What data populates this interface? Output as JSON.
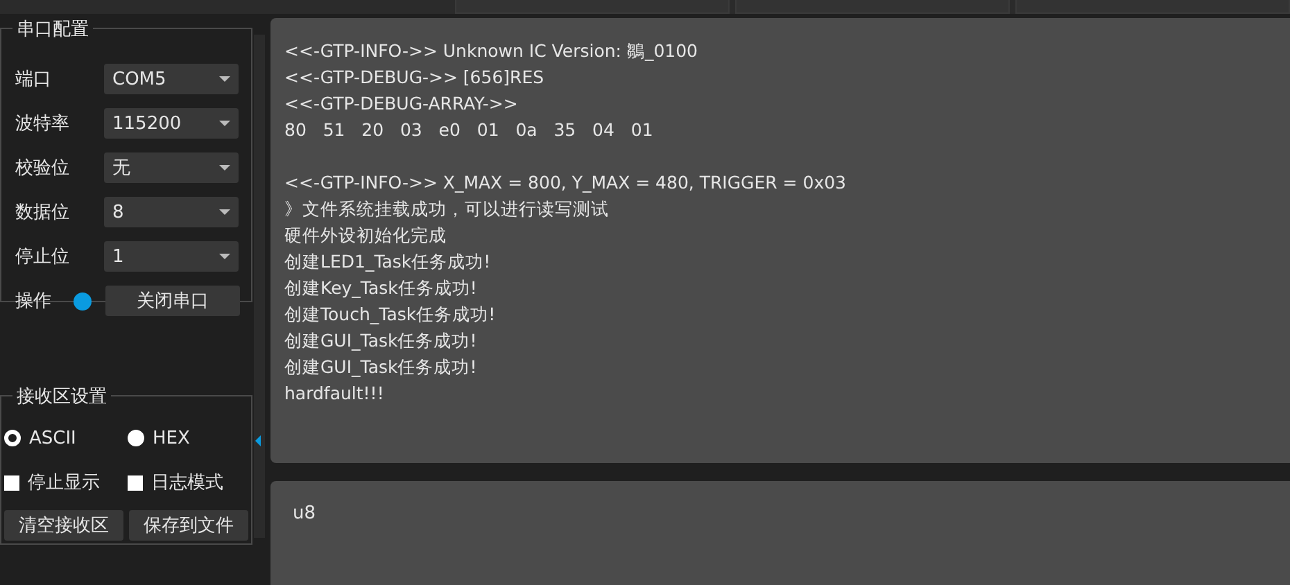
{
  "serial_config": {
    "title": "串口配置",
    "fields": [
      {
        "label": "端口",
        "value": "COM5"
      },
      {
        "label": "波特率",
        "value": "115200"
      },
      {
        "label": "校验位",
        "value": "无"
      },
      {
        "label": "数据位",
        "value": "8"
      },
      {
        "label": "停止位",
        "value": "1"
      }
    ],
    "operation": {
      "label": "操作",
      "port_open": true,
      "button": "关闭串口"
    }
  },
  "receive_settings": {
    "title": "接收区设置",
    "modes": [
      {
        "label": "ASCII",
        "selected": true
      },
      {
        "label": "HEX",
        "selected": false
      }
    ],
    "options": [
      {
        "label": "停止显示",
        "checked": false
      },
      {
        "label": "日志模式",
        "checked": false
      }
    ],
    "buttons": [
      "清空接收区",
      "保存到文件"
    ]
  },
  "receive_log": [
    [
      "<<-GTP-INFO->> Unknown IC Version: 鶵_0100",
      "<<-GTP-DEBUG->> [656]RES",
      "<<-GTP-DEBUG-ARRAY->>",
      "80   51   20   03   e0   01   0a   35   04   01"
    ],
    [
      "<<-GTP-INFO->> X_MAX = 800, Y_MAX = 480, TRIGGER = 0x03",
      "》文件系统挂载成功，可以进行读写测试",
      "硬件外设初始化完成",
      "创建LED1_Task任务成功!",
      "创建Key_Task任务成功!",
      "创建Touch_Task任务成功!",
      "创建GUI_Task任务成功!",
      "创建GUI_Task任务成功!",
      "hardfault!!!"
    ]
  ],
  "send_text": "u8"
}
